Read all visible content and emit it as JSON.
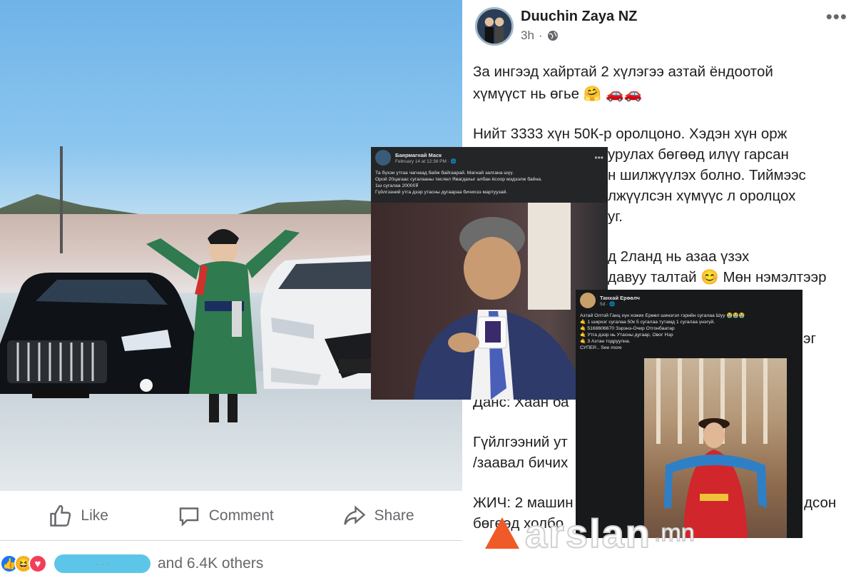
{
  "left_post": {
    "actions": [
      {
        "label": "Like",
        "icon": "thumbs-up-icon"
      },
      {
        "label": "Comment",
        "icon": "comment-icon"
      },
      {
        "label": "Share",
        "icon": "share-icon"
      }
    ],
    "reactions": {
      "emojis": [
        "like-icon",
        "haha-icon",
        "love-icon"
      ],
      "others_text": "and 6.4K others"
    }
  },
  "right_post": {
    "author": "Duuchin Zaya NZ",
    "time": "3h",
    "privacy_icon": "globe-icon",
    "more_icon": "more-dots-icon",
    "lines": [
      "За ингээд хайртай 2 хүлэгээ азтай ёндоотой",
      "хүмүүст нь өгье 🤗 🚗🚗",
      "",
      "Нийт 3333 хүн 50К-р оролцоно. Хэдэн хүн орж",
      "урулах бөгөөд илүү гарсан",
      "н шилжүүлэх болно. Тиймээс",
      "лжүүлсэн хүмүүс л оролцох",
      "уг.",
      "",
      "д 2ланд нь азаа үзэх",
      "давуу талтай 😊 Мөн нэмэлтээр",
      "эг",
      "Данс: Хаан ба",
      "",
      "Гүйлгээний ут",
      "/заавал бичих",
      "",
      "ЖИЧ: 2 машин",
      "бөгөөд холбо",
      "дсон"
    ]
  },
  "overlay_1": {
    "name": "Баярмагнай Маск",
    "time": "February 14 at 12:36 PM · 🌐",
    "text": [
      "Та бүхэн утгаа чагнаад байж байгаарай. Магнай залгана шүү.",
      "Орой 20цагаас сугалааны төслөл Явагдахыг албан ёсоор мэдээлж байна.",
      "1ш сугалаа 20000₮",
      "Гүйлгээний утга дээр утасны дугаараа бичихээ мартуузай."
    ]
  },
  "overlay_2": {
    "name": "Танхай Ерөөлч",
    "time": "5d · 🌐",
    "text": [
      "Азтай Олтой Ганц хүн хожих Ерөөл шинэгэл гэрийн сугалаа Шуу 😭😭😭",
      "🤙 1 ширхэг сугалаа 50к 5 сугалаа тутамд 1 сугалаа үнэгүй.",
      "🤙 5168606670 Зэрэнэ-Очир Отгонбаатар",
      "🤙 Утга дээр нь Утасны дугаар, Овог Нэр",
      "🤙 3 Азтан тодруулна.",
      "СУПЕР... See more"
    ]
  },
  "watermark": {
    "main": "arslan",
    "domain": ".mn"
  },
  "colors": {
    "facebook_gray": "#65676b",
    "text_dark": "#1c1e21",
    "watermark_orange": "#f05a28"
  }
}
